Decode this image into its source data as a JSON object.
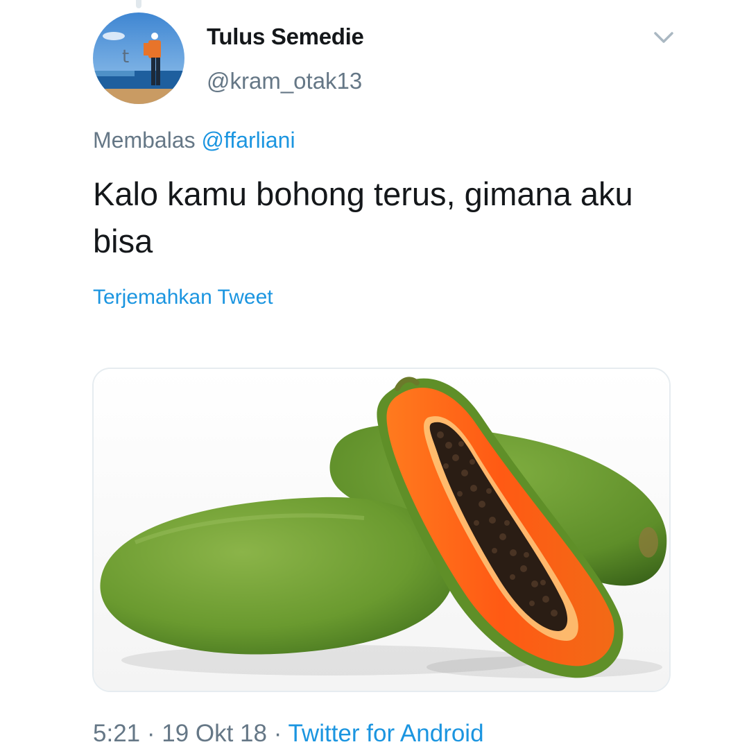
{
  "tweet": {
    "author": {
      "display_name": "Tulus Semedie",
      "handle": "@kram_otak13",
      "avatar_icon": "user-avatar-photo"
    },
    "reply_prefix": "Membalas",
    "reply_to": "@ffarliani",
    "text": "Kalo kamu bohong terus, gimana aku bisa",
    "translate_label": "Terjemahkan Tweet",
    "media_alt": "papaya-photo",
    "time": "5:21",
    "separator_1": " · ",
    "date": "19 Okt 18",
    "separator_2": " · ",
    "source": "Twitter for Android",
    "menu_icon": "chevron-down-icon"
  },
  "colors": {
    "text_primary": "#14171a",
    "text_secondary": "#657786",
    "link": "#1b95e0",
    "border": "#e6ecf0"
  }
}
